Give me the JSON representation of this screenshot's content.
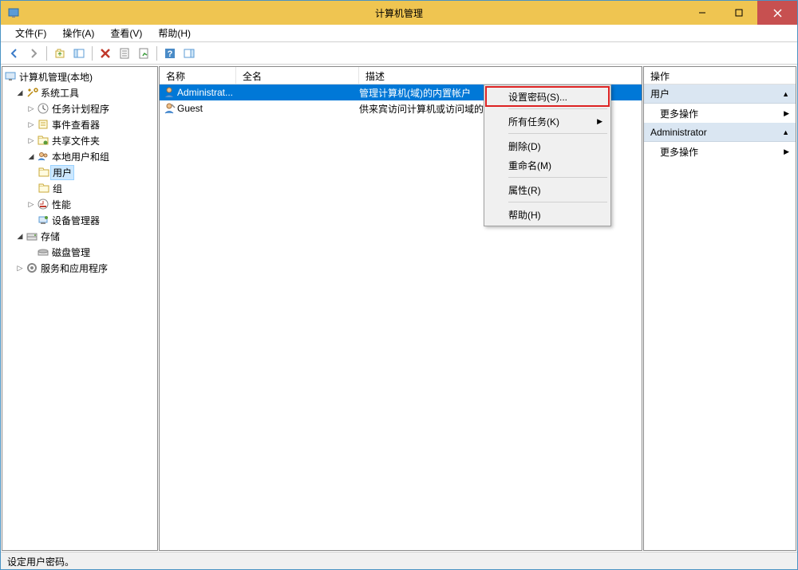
{
  "window": {
    "title": "计算机管理"
  },
  "menu": {
    "file": "文件(F)",
    "action": "操作(A)",
    "view": "查看(V)",
    "help": "帮助(H)"
  },
  "tree": {
    "root": "计算机管理(本地)",
    "systools": "系统工具",
    "tasksched": "任务计划程序",
    "eventvwr": "事件查看器",
    "shared": "共享文件夹",
    "localusers": "本地用户和组",
    "users": "用户",
    "groups": "组",
    "perf": "性能",
    "devmgr": "设备管理器",
    "storage": "存储",
    "diskmgmt": "磁盘管理",
    "services": "服务和应用程序"
  },
  "list": {
    "cols": {
      "name": "名称",
      "full": "全名",
      "desc": "描述"
    },
    "rows": [
      {
        "name": "Administrat...",
        "full": "",
        "desc": "管理计算机(域)的内置帐户"
      },
      {
        "name": "Guest",
        "full": "",
        "desc": "供来宾访问计算机或访问域的..."
      }
    ]
  },
  "ctx": {
    "setpw": "设置密码(S)...",
    "alltasks": "所有任务(K)",
    "delete": "删除(D)",
    "rename": "重命名(M)",
    "props": "属性(R)",
    "help": "帮助(H)"
  },
  "actions": {
    "header": "操作",
    "group_users": "用户",
    "more": "更多操作",
    "group_admin": "Administrator"
  },
  "status": "设定用户密码。"
}
